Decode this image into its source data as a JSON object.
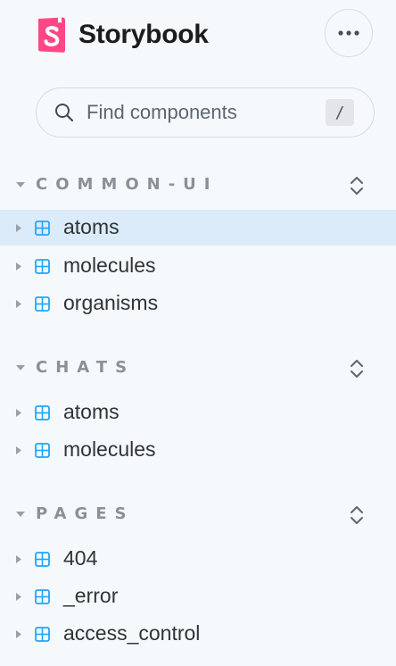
{
  "brand": {
    "name": "Storybook",
    "logo_icon": "storybook-logo-icon"
  },
  "menu": {
    "icon": "ellipsis-icon"
  },
  "search": {
    "placeholder": "Find components",
    "shortcut": "/"
  },
  "colors": {
    "background": "#f6f9fc",
    "selected": "#dcebfa",
    "component_icon": "#1ea7fd",
    "brand": "#ff4785"
  },
  "sections": [
    {
      "title": "COMMON-UI",
      "items": [
        {
          "label": "atoms",
          "selected": true
        },
        {
          "label": "molecules"
        },
        {
          "label": "organisms"
        }
      ]
    },
    {
      "title": "CHATS",
      "items": [
        {
          "label": "atoms"
        },
        {
          "label": "molecules"
        }
      ]
    },
    {
      "title": "PAGES",
      "items": [
        {
          "label": "404"
        },
        {
          "label": "_error"
        },
        {
          "label": "access_control"
        }
      ]
    }
  ]
}
